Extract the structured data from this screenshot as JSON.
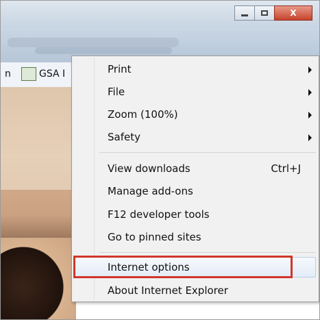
{
  "window": {
    "minimize_icon": "minimize-icon",
    "maximize_icon": "maximize-icon",
    "close_label": "X"
  },
  "toolbar": {
    "icons": [
      "home-icon",
      "star-icon",
      "gear-icon"
    ]
  },
  "favorites": {
    "partial_text": "n",
    "item_label": "GSA I"
  },
  "menu": {
    "items": [
      {
        "label": "Print",
        "submenu": true
      },
      {
        "label": "File",
        "submenu": true
      },
      {
        "label": "Zoom (100%)",
        "submenu": true
      },
      {
        "label": "Safety",
        "submenu": true
      },
      {
        "label": "View downloads",
        "shortcut": "Ctrl+J"
      },
      {
        "label": "Manage add-ons"
      },
      {
        "label": "F12 developer tools"
      },
      {
        "label": "Go to pinned sites"
      },
      {
        "label": "Internet options",
        "highlighted": true
      },
      {
        "label": "About Internet Explorer"
      }
    ]
  },
  "colors": {
    "highlight_outline": "#d0362b",
    "close_button": "#c7432b",
    "gear_icon": "#2f6fb5"
  }
}
